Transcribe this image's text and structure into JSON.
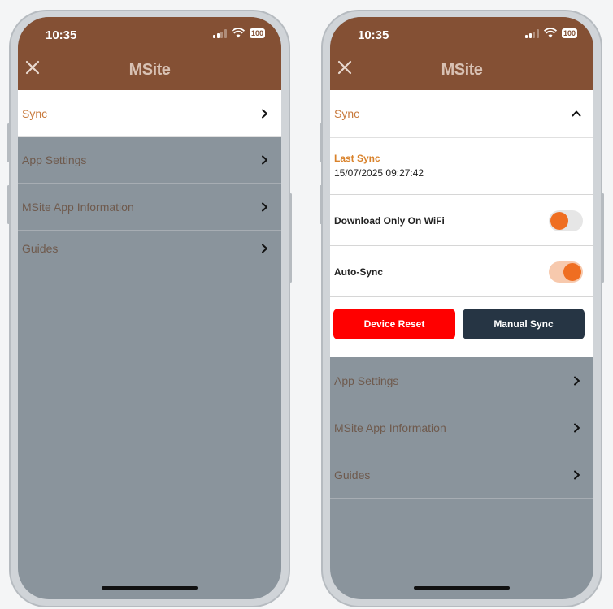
{
  "status_bar": {
    "time": "10:35",
    "battery": "100"
  },
  "app": {
    "logo_text": "MSite"
  },
  "colors": {
    "header": "#845034",
    "accent": "#d9822b",
    "toggle": "#ef6e21",
    "reset": "#ff0000",
    "manual": "#263544"
  },
  "left_screen": {
    "menu": [
      {
        "label": "Sync",
        "active": true
      },
      {
        "label": "App Settings"
      },
      {
        "label": "MSite App Information"
      },
      {
        "label": "Guides"
      }
    ]
  },
  "right_screen": {
    "sync_label": "Sync",
    "last_sync_title": "Last Sync",
    "last_sync_value": "15/07/2025 09:27:42",
    "download_wifi_label": "Download Only On WiFi",
    "download_wifi_on": false,
    "auto_sync_label": "Auto-Sync",
    "auto_sync_on": true,
    "device_reset_label": "Device Reset",
    "manual_sync_label": "Manual Sync",
    "menu": [
      {
        "label": "App Settings"
      },
      {
        "label": "MSite App Information"
      },
      {
        "label": "Guides"
      }
    ]
  },
  "icons": {
    "close": "close-icon",
    "chevron_right": "chevron-right-icon",
    "chevron_up": "chevron-up-icon"
  }
}
